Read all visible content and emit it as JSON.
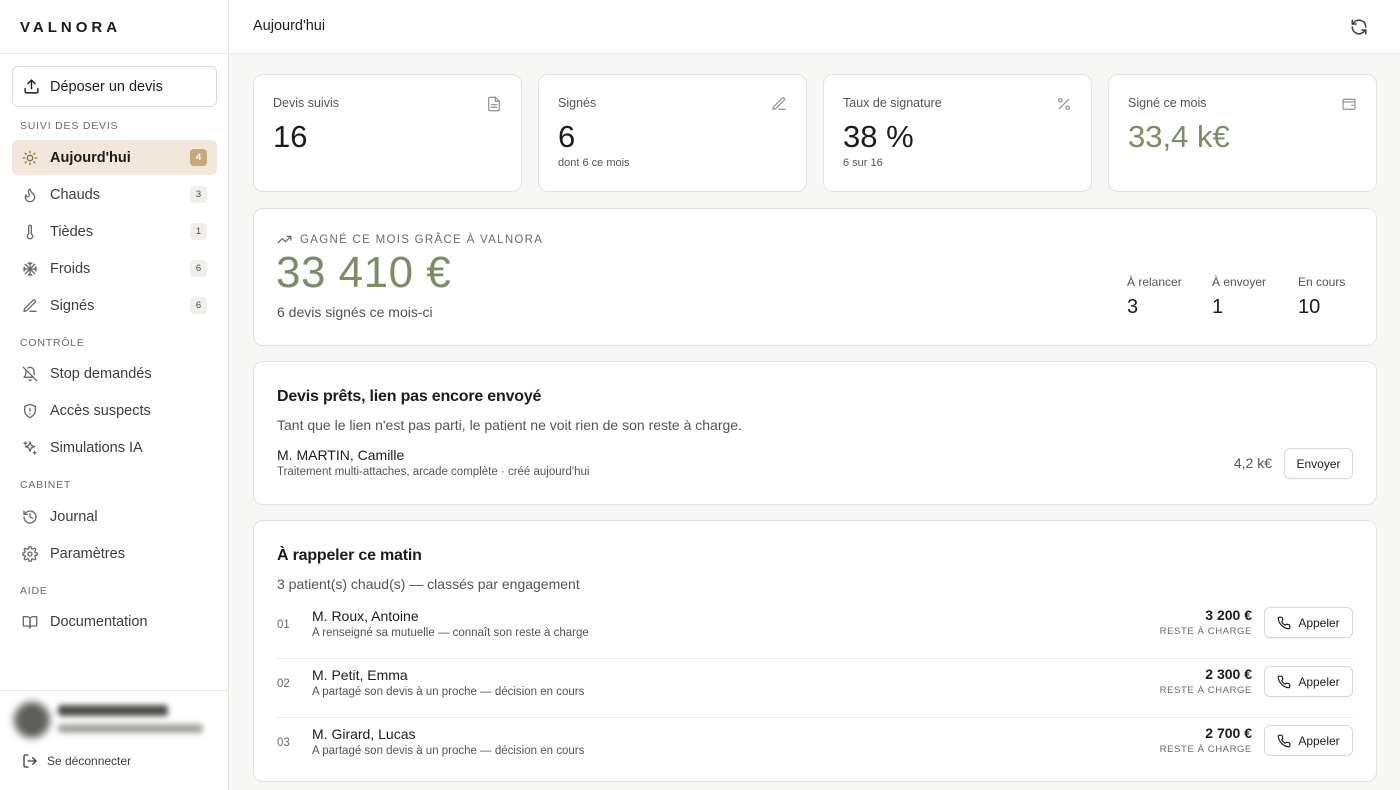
{
  "brand": "VALNORA",
  "sidebar": {
    "upload_label": "Déposer un devis",
    "sections": {
      "suivi": "SUIVI DES DEVIS",
      "controle": "CONTRÔLE",
      "cabinet": "CABINET",
      "aide": "AIDE"
    },
    "items": [
      {
        "label": "Aujourd'hui",
        "count": "4",
        "icon": "sun-icon"
      },
      {
        "label": "Chauds",
        "count": "3",
        "icon": "flame-icon"
      },
      {
        "label": "Tièdes",
        "count": "1",
        "icon": "thermometer-icon"
      },
      {
        "label": "Froids",
        "count": "6",
        "icon": "snowflake-icon"
      },
      {
        "label": "Signés",
        "count": "6",
        "icon": "pen-icon"
      },
      {
        "label": "Stop demandés",
        "icon": "bell-off-icon"
      },
      {
        "label": "Accès suspects",
        "icon": "shield-icon"
      },
      {
        "label": "Simulations IA",
        "icon": "sparkles-icon"
      },
      {
        "label": "Journal",
        "icon": "history-icon"
      },
      {
        "label": "Paramètres",
        "icon": "gear-icon"
      },
      {
        "label": "Documentation",
        "icon": "book-icon"
      }
    ],
    "logout_label": "Se déconnecter"
  },
  "header": {
    "title": "Aujourd'hui"
  },
  "stats": [
    {
      "label": "Devis suivis",
      "value": "16",
      "sub": "",
      "icon": "document-icon"
    },
    {
      "label": "Signés",
      "value": "6",
      "sub": "dont 6 ce mois",
      "icon": "pen-icon"
    },
    {
      "label": "Taux de signature",
      "value": "38 %",
      "sub": "6 sur 16",
      "icon": "percent-icon"
    },
    {
      "label": "Signé ce mois",
      "value": "33,4 k€",
      "sub": "",
      "icon": "wallet-icon"
    }
  ],
  "gain": {
    "title": "GAGNÉ CE MOIS GRÂCE À VALNORA",
    "amount": "33 410 €",
    "sub": "6 devis signés ce mois-ci",
    "metrics": [
      {
        "label": "À relancer",
        "value": "3"
      },
      {
        "label": "À envoyer",
        "value": "1"
      },
      {
        "label": "En cours",
        "value": "10"
      }
    ]
  },
  "ready": {
    "title": "Devis prêts, lien pas encore envoyé",
    "desc": "Tant que le lien n'est pas parti, le patient ne voit rien de son reste à charge.",
    "patient": {
      "name": "M. MARTIN, Camille",
      "note": "Traitement multi-attaches, arcade complète · créé aujourd'hui",
      "amount": "4,2 k€"
    },
    "button": "Envoyer"
  },
  "callback": {
    "title": "À rappeler ce matin",
    "desc": "3 patient(s) chaud(s) — classés par engagement",
    "amount_label": "RESTE À CHARGE",
    "button": "Appeler",
    "rows": [
      {
        "idx": "01",
        "name": "M. Roux, Antoine",
        "note": "A renseigné sa mutuelle — connaît son reste à charge",
        "amount": "3 200 €"
      },
      {
        "idx": "02",
        "name": "M. Petit, Emma",
        "note": "A partagé son devis à un proche — décision en cours",
        "amount": "2 300 €"
      },
      {
        "idx": "03",
        "name": "M. Girard, Lucas",
        "note": "A partagé son devis à un proche — décision en cours",
        "amount": "2 700 €"
      }
    ]
  }
}
